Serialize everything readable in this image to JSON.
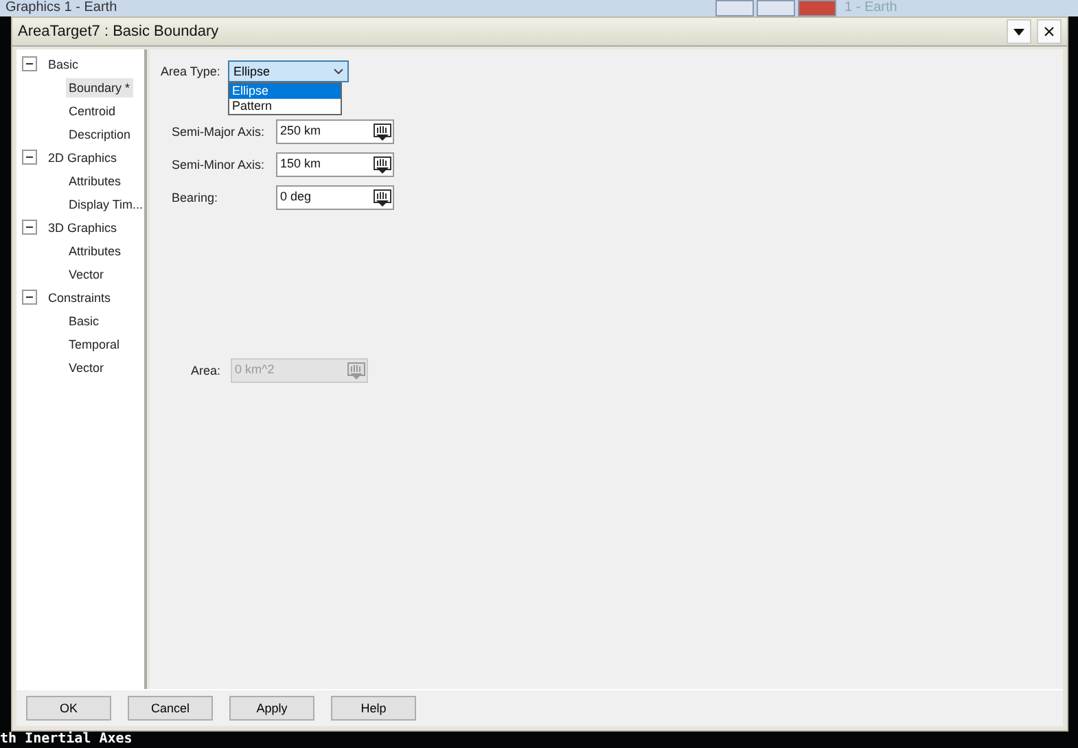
{
  "background_window": {
    "title": "Graphics 1 - Earth",
    "second_title": "1 - Earth",
    "status_text": "th Inertial Axes"
  },
  "dialog": {
    "title": "AreaTarget7 : Basic Boundary"
  },
  "tree": [
    {
      "label": "Basic",
      "expanded": true,
      "children": [
        {
          "label": "Boundary *",
          "selected": true
        },
        {
          "label": "Centroid",
          "selected": false
        },
        {
          "label": "Description",
          "selected": false
        }
      ]
    },
    {
      "label": "2D Graphics",
      "expanded": true,
      "children": [
        {
          "label": "Attributes",
          "selected": false
        },
        {
          "label": "Display Tim...",
          "selected": false
        }
      ]
    },
    {
      "label": "3D Graphics",
      "expanded": true,
      "children": [
        {
          "label": "Attributes",
          "selected": false
        },
        {
          "label": "Vector",
          "selected": false
        }
      ]
    },
    {
      "label": "Constraints",
      "expanded": true,
      "children": [
        {
          "label": "Basic",
          "selected": false
        },
        {
          "label": "Temporal",
          "selected": false
        },
        {
          "label": "Vector",
          "selected": false
        }
      ]
    }
  ],
  "area_type": {
    "label": "Area Type:",
    "value": "Ellipse",
    "expanded": true,
    "options": [
      {
        "label": "Ellipse",
        "selected": true
      },
      {
        "label": "Pattern",
        "selected": false
      }
    ]
  },
  "fields": [
    {
      "label": "Semi-Major Axis:",
      "value": "250 km",
      "disabled": false
    },
    {
      "label": "Semi-Minor Axis:",
      "value": "150 km",
      "disabled": false
    },
    {
      "label": "Bearing:",
      "value": "0 deg",
      "disabled": false
    }
  ],
  "area": {
    "label": "Area:",
    "value": "0 km^2",
    "disabled": true
  },
  "buttons": [
    "OK",
    "Cancel",
    "Apply",
    "Help"
  ]
}
